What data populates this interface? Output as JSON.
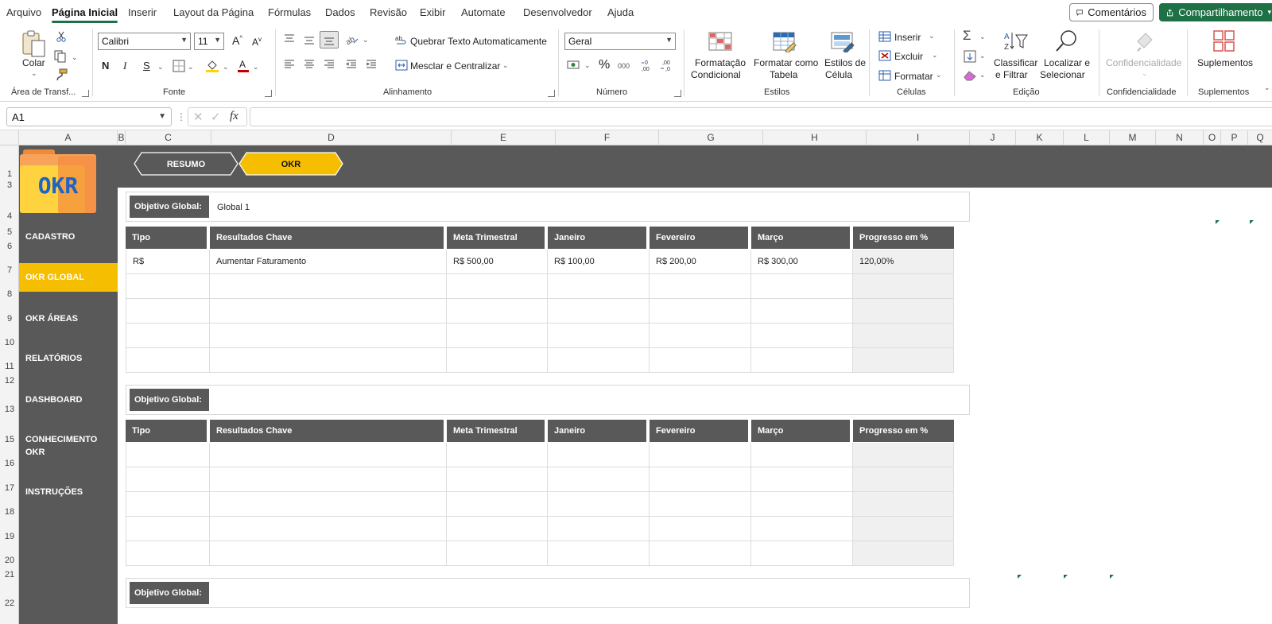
{
  "menubar": {
    "tabs": [
      "Arquivo",
      "Página Inicial",
      "Inserir",
      "Layout da Página",
      "Fórmulas",
      "Dados",
      "Revisão",
      "Exibir",
      "Automate",
      "Desenvolvedor",
      "Ajuda"
    ],
    "active_tab": "Página Inicial",
    "comments_label": "Comentários",
    "share_label": "Compartilhamento"
  },
  "ribbon": {
    "clipboard": {
      "paste_label": "Colar",
      "group_label": "Área de Transf..."
    },
    "font": {
      "name": "Calibri",
      "size": "11",
      "group_label": "Fonte"
    },
    "alignment": {
      "wrap_label": "Quebrar Texto Automaticamente",
      "merge_label": "Mesclar e Centralizar",
      "group_label": "Alinhamento"
    },
    "number": {
      "format": "Geral",
      "group_label": "Número"
    },
    "styles": {
      "cond_format_l1": "Formatação",
      "cond_format_l2": "Condicional",
      "format_table_l1": "Formatar como",
      "format_table_l2": "Tabela",
      "cell_styles_l1": "Estilos de",
      "cell_styles_l2": "Célula",
      "group_label": "Estilos"
    },
    "cells": {
      "insert_label": "Inserir",
      "delete_label": "Excluir",
      "format_label": "Formatar",
      "group_label": "Células"
    },
    "editing": {
      "sort_l1": "Classificar",
      "sort_l2": "e Filtrar",
      "find_l1": "Localizar e",
      "find_l2": "Selecionar",
      "group_label": "Edição"
    },
    "sensitivity": {
      "label": "Confidencialidade",
      "group_label": "Confidencialidade"
    },
    "addins": {
      "label": "Suplementos",
      "group_label": "Suplementos"
    }
  },
  "formula_bar": {
    "name_box": "A1",
    "fx": "fx",
    "value": ""
  },
  "columns": [
    "A",
    "B",
    "C",
    "D",
    "E",
    "F",
    "G",
    "H",
    "I",
    "J",
    "K",
    "L",
    "M",
    "N",
    "O",
    "P",
    "Q"
  ],
  "rows": [
    "1",
    "3",
    "4",
    "5",
    "6",
    "7",
    "8",
    "9",
    "10",
    "11",
    "12",
    "13",
    "15",
    "16",
    "17",
    "18",
    "19",
    "20",
    "21",
    "22"
  ],
  "sheet": {
    "logo_text": "OKR",
    "nav_tabs": [
      {
        "label": "RESUMO",
        "active": false
      },
      {
        "label": "OKR",
        "active": true
      }
    ],
    "sidebar": [
      {
        "label": "CADASTRO",
        "active": false
      },
      {
        "label": "OKR GLOBAL",
        "active": true
      },
      {
        "label": "OKR ÁREAS",
        "active": false
      },
      {
        "label": "RELATÓRIOS",
        "active": false
      },
      {
        "label": "DASHBOARD",
        "active": false
      },
      {
        "label": "CONHECIMENTO OKR",
        "active": false
      },
      {
        "label": "INSTRUÇÕES",
        "active": false
      }
    ],
    "objective_label": "Objetivo Global:",
    "table_headers": [
      "Tipo",
      "Resultados Chave",
      "Meta Trimestral",
      "Janeiro",
      "Fevereiro",
      "Março",
      "Progresso em %"
    ],
    "blocks": [
      {
        "objective": "Global 1",
        "rows": [
          [
            "R$",
            "Aumentar Faturamento",
            "R$ 500,00",
            "R$ 100,00",
            "R$ 200,00",
            "R$ 300,00",
            "120,00%"
          ],
          [
            "",
            "",
            "",
            "",
            "",
            "",
            ""
          ],
          [
            "",
            "",
            "",
            "",
            "",
            "",
            ""
          ],
          [
            "",
            "",
            "",
            "",
            "",
            "",
            ""
          ],
          [
            "",
            "",
            "",
            "",
            "",
            "",
            ""
          ]
        ]
      },
      {
        "objective": "",
        "rows": [
          [
            "",
            "",
            "",
            "",
            "",
            "",
            ""
          ],
          [
            "",
            "",
            "",
            "",
            "",
            "",
            ""
          ],
          [
            "",
            "",
            "",
            "",
            "",
            "",
            ""
          ],
          [
            "",
            "",
            "",
            "",
            "",
            "",
            ""
          ],
          [
            "",
            "",
            "",
            "",
            "",
            "",
            ""
          ]
        ]
      },
      {
        "objective": "",
        "rows": []
      }
    ]
  }
}
